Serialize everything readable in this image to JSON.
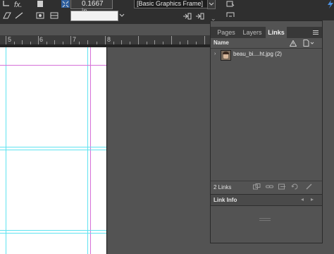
{
  "toolbar": {
    "fx_label": "fx.",
    "stroke_weight": "0.1667 in",
    "object_style": "[Basic Graphics Frame]",
    "stroke_swatch_color": "#f2f2f2"
  },
  "ruler": {
    "numbers": [
      "5",
      "6",
      "7",
      "8"
    ]
  },
  "panel": {
    "tabs": [
      "Pages",
      "Layers",
      "Links"
    ],
    "active_tab": "Links",
    "column_header": "Name",
    "links": [
      {
        "name": "beau_bi....ht.jpg (2)"
      }
    ],
    "footer_count": "2 Links",
    "link_info_label": "Link Info",
    "close_glyph": "×"
  },
  "colors": {
    "guide_cyan": "#5fe3f0",
    "guide_magenta": "#d670d8",
    "panel_bg": "#535353",
    "toolbar_bg": "#2f2f2f"
  },
  "icons": {
    "row_arrow": "›",
    "prev": "◂",
    "next": "▸",
    "dropdown": "▾"
  }
}
